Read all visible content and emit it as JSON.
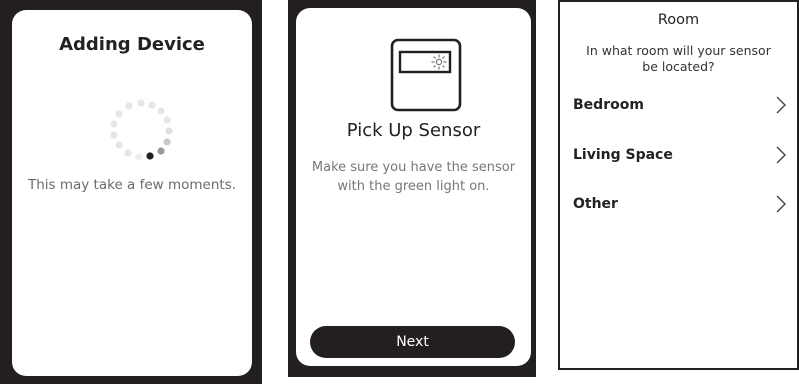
{
  "screen1": {
    "title": "Adding Device",
    "message": "This may take a few moments."
  },
  "screen2": {
    "title": "Pick Up Sensor",
    "message_line1": "Make sure you have the sensor",
    "message_line2": "with the green light on.",
    "next_label": "Next"
  },
  "screen3": {
    "title": "Room",
    "question_line1": "In what room will your sensor",
    "question_line2": "be located?",
    "options": [
      {
        "label": "Bedroom",
        "icon": "chevron-right-icon"
      },
      {
        "label": "Living Space",
        "icon": "chevron-right-icon"
      },
      {
        "label": "Other",
        "icon": "chevron-right-icon"
      }
    ]
  },
  "colors": {
    "frame": "#231f20",
    "button": "#231f20",
    "muted_text": "#777777"
  }
}
